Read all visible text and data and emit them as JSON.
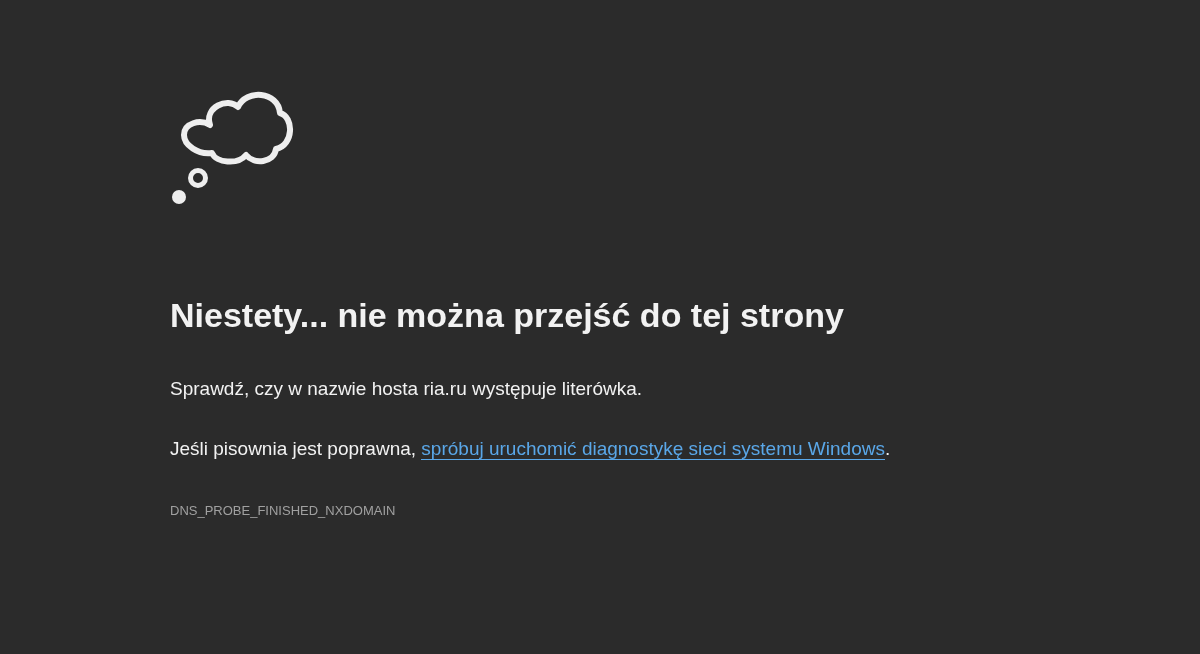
{
  "title": "Niestety... nie można przejść do tej strony",
  "hint": "Sprawdź, czy w nazwie hosta ria.ru występuje literówka.",
  "suggestion": {
    "prefix": "Jeśli pisownia jest poprawna, ",
    "link": "spróbuj uruchomić diagnostykę sieci systemu Windows",
    "suffix": "."
  },
  "error_code": "DNS_PROBE_FINISHED_NXDOMAIN"
}
